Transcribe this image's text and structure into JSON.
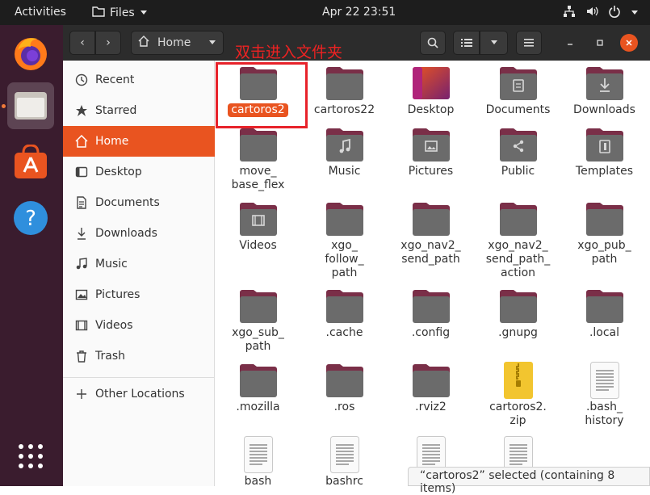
{
  "topbar": {
    "activities": "Activities",
    "app_name": "Files",
    "clock": "Apr 22  23:51"
  },
  "dock": {
    "items": [
      {
        "name": "firefox"
      },
      {
        "name": "files",
        "active": true
      },
      {
        "name": "ubuntu-software"
      },
      {
        "name": "help"
      },
      {
        "name": "show-applications"
      }
    ]
  },
  "header": {
    "location": "Home"
  },
  "annotation": "双击进入文件夹",
  "sidebar": {
    "items": [
      {
        "label": "Recent",
        "icon": "clock-icon"
      },
      {
        "label": "Starred",
        "icon": "star-icon"
      },
      {
        "label": "Home",
        "icon": "home-icon",
        "selected": true
      },
      {
        "label": "Desktop",
        "icon": "desktop-icon"
      },
      {
        "label": "Documents",
        "icon": "document-icon"
      },
      {
        "label": "Downloads",
        "icon": "download-icon"
      },
      {
        "label": "Music",
        "icon": "music-icon"
      },
      {
        "label": "Pictures",
        "icon": "picture-icon"
      },
      {
        "label": "Videos",
        "icon": "video-icon"
      },
      {
        "label": "Trash",
        "icon": "trash-icon"
      }
    ],
    "other": "Other Locations"
  },
  "files": [
    {
      "label": "cartoros2",
      "kind": "folder",
      "selected": true
    },
    {
      "label": "cartoros22",
      "kind": "folder"
    },
    {
      "label": "Desktop",
      "kind": "desktop"
    },
    {
      "label": "Documents",
      "kind": "folder-doc"
    },
    {
      "label": "Downloads",
      "kind": "folder-down"
    },
    {
      "label": "move_\nbase_flex",
      "kind": "folder"
    },
    {
      "label": "Music",
      "kind": "folder-music"
    },
    {
      "label": "Pictures",
      "kind": "folder-pic"
    },
    {
      "label": "Public",
      "kind": "folder-share"
    },
    {
      "label": "Templates",
      "kind": "folder-tpl"
    },
    {
      "label": "Videos",
      "kind": "folder-video"
    },
    {
      "label": "xgo_\nfollow_\npath",
      "kind": "folder"
    },
    {
      "label": "xgo_nav2_\nsend_path",
      "kind": "folder"
    },
    {
      "label": "xgo_nav2_\nsend_path_\naction",
      "kind": "folder"
    },
    {
      "label": "xgo_pub_\npath",
      "kind": "folder"
    },
    {
      "label": "xgo_sub_\npath",
      "kind": "folder"
    },
    {
      "label": ".cache",
      "kind": "folder"
    },
    {
      "label": ".config",
      "kind": "folder"
    },
    {
      "label": ".gnupg",
      "kind": "folder"
    },
    {
      "label": ".local",
      "kind": "folder"
    },
    {
      "label": ".mozilla",
      "kind": "folder"
    },
    {
      "label": ".ros",
      "kind": "folder"
    },
    {
      "label": ".rviz2",
      "kind": "folder"
    },
    {
      "label": "cartoros2.\nzip",
      "kind": "zip"
    },
    {
      "label": ".bash_\nhistory",
      "kind": "text"
    },
    {
      "label": "bash",
      "kind": "text"
    },
    {
      "label": "bashrc",
      "kind": "text"
    },
    {
      "label": "",
      "kind": "text"
    },
    {
      "label": "",
      "kind": "text"
    }
  ],
  "status": "“cartoros2” selected  (containing 8 items)",
  "colors": {
    "accent": "#e95420",
    "folder_body": "#6b6b6b",
    "folder_tab": "#7a2f48",
    "dock_bg": "#3a1c2e"
  }
}
